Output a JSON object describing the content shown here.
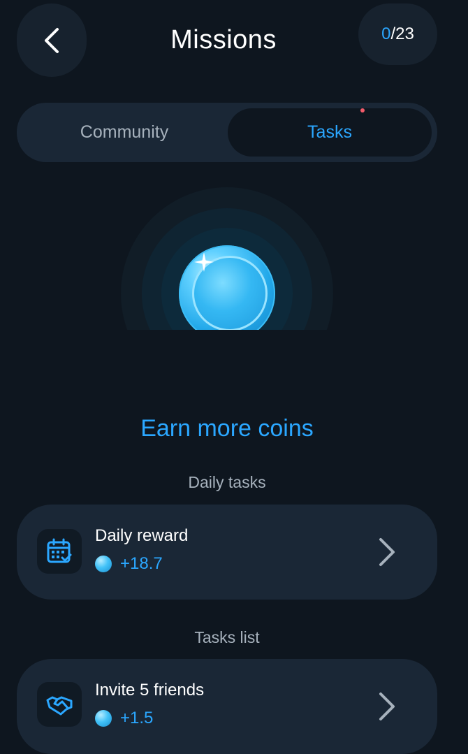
{
  "header": {
    "title": "Missions",
    "progress_done": "0",
    "progress_total": "/23"
  },
  "tabs": [
    {
      "label": "Community",
      "active": false
    },
    {
      "label": "Tasks",
      "active": true,
      "has_notification_dot": true
    }
  ],
  "hero": {
    "headline": "Earn more coins"
  },
  "daily_section": {
    "label": "Daily tasks",
    "items": [
      {
        "title": "Daily reward",
        "reward": "+18.7",
        "icon": "calendar-check-icon"
      }
    ]
  },
  "tasks_section": {
    "label": "Tasks list",
    "items": [
      {
        "title": "Invite 5 friends",
        "reward": "+1.5",
        "icon": "handshake-icon"
      }
    ]
  },
  "colors": {
    "background": "#0e161f",
    "surface": "#1a2736",
    "accent": "#2ba7ff",
    "muted_text": "#a7b2bd",
    "notification_dot": "#f25b6a"
  }
}
